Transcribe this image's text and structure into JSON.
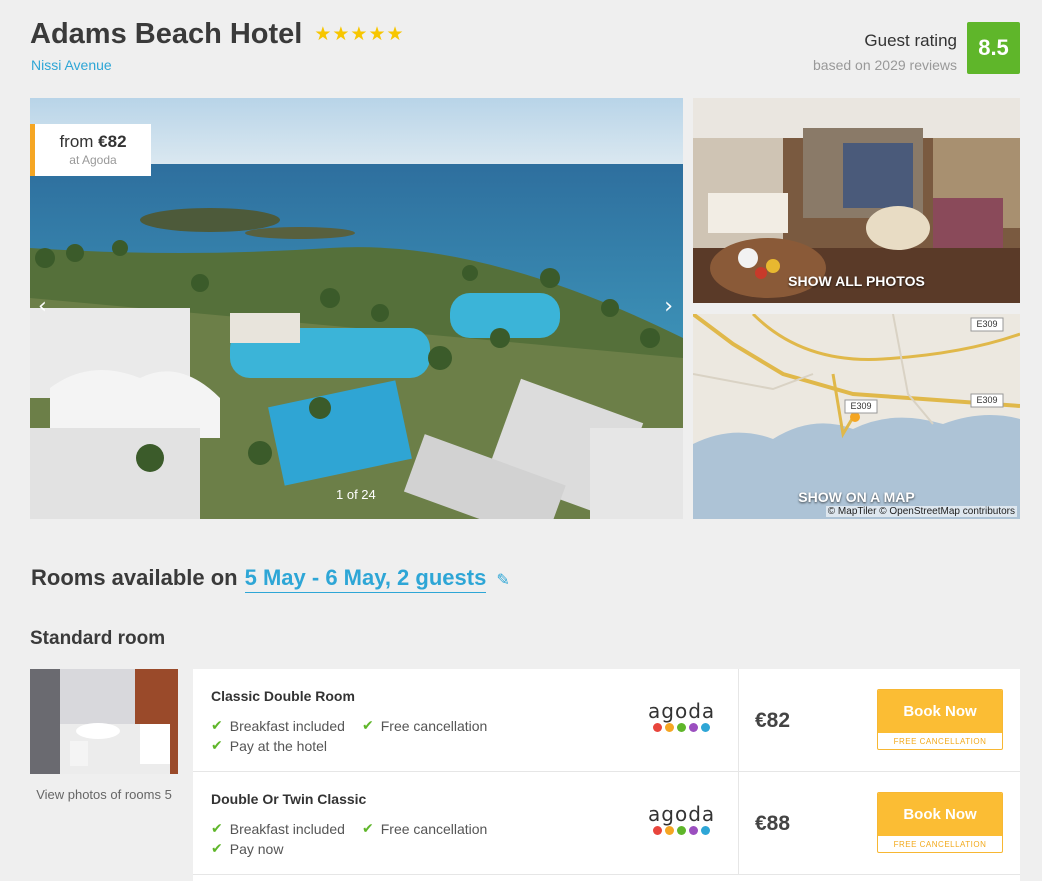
{
  "hotel": {
    "name": "Adams Beach Hotel",
    "stars": "★★★★★",
    "address": "Nissi Avenue"
  },
  "rating": {
    "label": "Guest rating",
    "reviews": "based on 2029 reviews",
    "score": "8.5",
    "color": "#5fb62a"
  },
  "gallery": {
    "price_prefix": "from ",
    "price": "€82",
    "price_source": "at Agoda",
    "counter": "1 of 24",
    "prev_icon": "chevron-left-icon",
    "next_icon": "chevron-right-icon",
    "show_photos": "SHOW ALL PHOTOS",
    "show_map": "SHOW ON A MAP",
    "map_attribution": "© MapTiler © OpenStreetMap contributors",
    "map_road_labels": [
      "E309",
      "E309",
      "E309"
    ]
  },
  "rooms": {
    "heading": "Rooms available on",
    "dates": "5 May - 6 May, 2 guests",
    "edit_icon": "pencil-icon",
    "room_type": "Standard room",
    "view_photos": "View photos of rooms 5",
    "offers": [
      {
        "name": "Classic Double Room",
        "features": [
          "Breakfast included",
          "Free cancellation",
          "Pay at the hotel"
        ],
        "provider": "agoda",
        "price": "€82",
        "book_label": "Book Now",
        "book_sub": "FREE CANCELLATION"
      },
      {
        "name": "Double Or Twin Classic",
        "features": [
          "Breakfast included",
          "Free cancellation",
          "Pay now"
        ],
        "provider": "agoda",
        "price": "€88",
        "book_label": "Book Now",
        "book_sub": "FREE CANCELLATION"
      }
    ]
  },
  "colors": {
    "accent": "#2ea6d6",
    "book_button": "#fbbd34",
    "price_tag_border": "#f5a623",
    "check": "#5fb62a",
    "agoda_dots": [
      "#e8453c",
      "#f5a623",
      "#5fb62a",
      "#9b4fbf",
      "#2ea6d6"
    ]
  }
}
